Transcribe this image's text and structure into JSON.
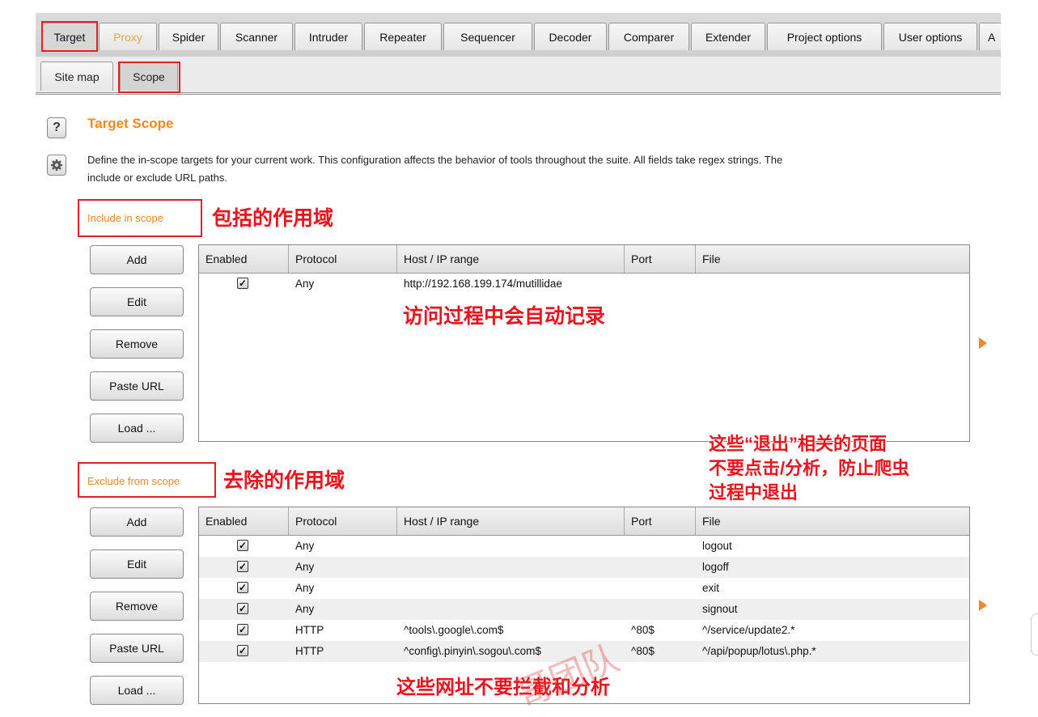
{
  "tabs": [
    {
      "label": "Target"
    },
    {
      "label": "Proxy"
    },
    {
      "label": "Spider"
    },
    {
      "label": "Scanner"
    },
    {
      "label": "Intruder"
    },
    {
      "label": "Repeater"
    },
    {
      "label": "Sequencer"
    },
    {
      "label": "Decoder"
    },
    {
      "label": "Comparer"
    },
    {
      "label": "Extender"
    },
    {
      "label": "Project options"
    },
    {
      "label": "User options"
    },
    {
      "label": "A"
    }
  ],
  "subtabs": [
    {
      "label": "Site map"
    },
    {
      "label": "Scope"
    }
  ],
  "section": {
    "title": "Target Scope",
    "description_line1": "Define the in-scope targets for your current work. This configuration affects the behavior of tools throughout the suite. All fields take regex strings. The",
    "description_line2": "include or exclude URL paths."
  },
  "include": {
    "label": "Include in scope",
    "annotation": "包括的作用域",
    "buttons": [
      "Add",
      "Edit",
      "Remove",
      "Paste URL",
      "Load ..."
    ],
    "columns": [
      "Enabled",
      "Protocol",
      "Host / IP range",
      "Port",
      "File"
    ],
    "rows": [
      {
        "enabled": true,
        "protocol": "Any",
        "host": "http://192.168.199.174/mutillidae",
        "port": "",
        "file": ""
      }
    ],
    "table_annotation": "访问过程中会自动记录"
  },
  "exclude": {
    "label": "Exclude from scope",
    "annotation": "去除的作用域",
    "note_line1": "这些“退出”相关的页面",
    "note_line2": "不要点击/分析，防止爬虫",
    "note_line3": "过程中退出",
    "buttons": [
      "Add",
      "Edit",
      "Remove",
      "Paste URL",
      "Load ..."
    ],
    "columns": [
      "Enabled",
      "Protocol",
      "Host / IP range",
      "Port",
      "File"
    ],
    "rows": [
      {
        "enabled": true,
        "protocol": "Any",
        "host": "",
        "port": "",
        "file": "logout"
      },
      {
        "enabled": true,
        "protocol": "Any",
        "host": "",
        "port": "",
        "file": "logoff"
      },
      {
        "enabled": true,
        "protocol": "Any",
        "host": "",
        "port": "",
        "file": "exit"
      },
      {
        "enabled": true,
        "protocol": "Any",
        "host": "",
        "port": "",
        "file": "signout"
      },
      {
        "enabled": true,
        "protocol": "HTTP",
        "host": "^tools\\.google\\.com$",
        "port": "^80$",
        "file": "^/service/update2.*"
      },
      {
        "enabled": true,
        "protocol": "HTTP",
        "host": "^config\\.pinyin\\.sogou\\.com$",
        "port": "^80$",
        "file": "^/api/popup/lotus\\.php.*"
      }
    ],
    "table_annotation": "这些网址不要拦截和分析"
  },
  "icons": {
    "help": "help-icon",
    "settings": "gear-icon",
    "expand": "triangle-right-icon"
  },
  "colors": {
    "accent": "#f08a24",
    "annotation_red": "#e8141e"
  }
}
